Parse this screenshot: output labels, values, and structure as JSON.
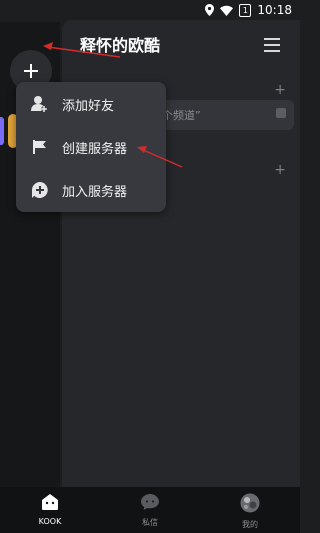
{
  "status_bar": {
    "time": "10:18",
    "battery": "1"
  },
  "server": {
    "title": "释怀的欧酷",
    "channel_placeholder": "个频道”"
  },
  "popup_menu": {
    "items": [
      {
        "label": "添加好友"
      },
      {
        "label": "创建服务器"
      },
      {
        "label": "加入服务器"
      }
    ]
  },
  "bottom_nav": {
    "items": [
      {
        "label": "KOOK"
      },
      {
        "label": "私信"
      },
      {
        "label": "我的"
      }
    ]
  },
  "colors": {
    "accent": "#7b6cf6",
    "annotation_arrow": "#d42a2a",
    "background": "#1d1e20",
    "panel": "#26272b",
    "popup": "#38393e"
  }
}
